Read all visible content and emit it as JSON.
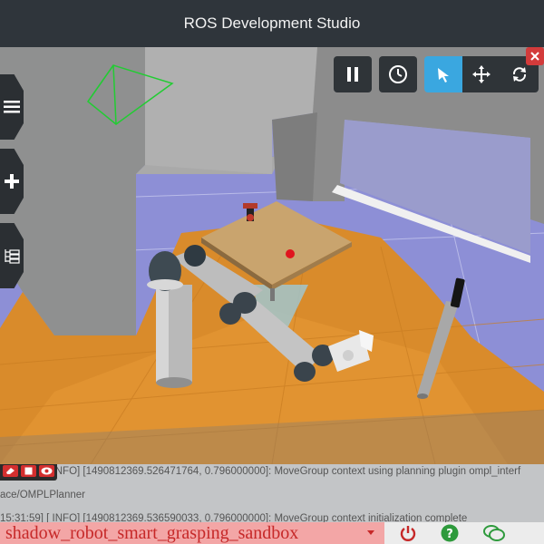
{
  "header": {
    "title": "ROS Development Studio"
  },
  "sidebar": {
    "items": [
      {
        "icon": "menu-icon"
      },
      {
        "icon": "plus-icon"
      },
      {
        "icon": "tree-icon"
      }
    ]
  },
  "toolbar": {
    "buttons": [
      {
        "icon": "pause-icon",
        "active": false
      },
      {
        "icon": "clock-icon",
        "active": false
      },
      {
        "icon": "pointer-icon",
        "active": true
      },
      {
        "icon": "move-icon",
        "active": false
      },
      {
        "icon": "rotate-icon",
        "active": false
      }
    ]
  },
  "console": {
    "lines": [
      "15:31:59] [ INFO] [1490812369.526471764, 0.796000000]: MoveGroup context using planning plugin ompl_interf",
      "ace/OMPLPlanner",
      "15:31:59] [ INFO] [1490812369.536590033, 0.796000000]: MoveGroup context initialization complete"
    ]
  },
  "footer": {
    "project": "shadow_robot_smart_grasping_sandbox",
    "colors": {
      "accent_red": "#c62828",
      "help_green": "#2e9a3c"
    }
  }
}
